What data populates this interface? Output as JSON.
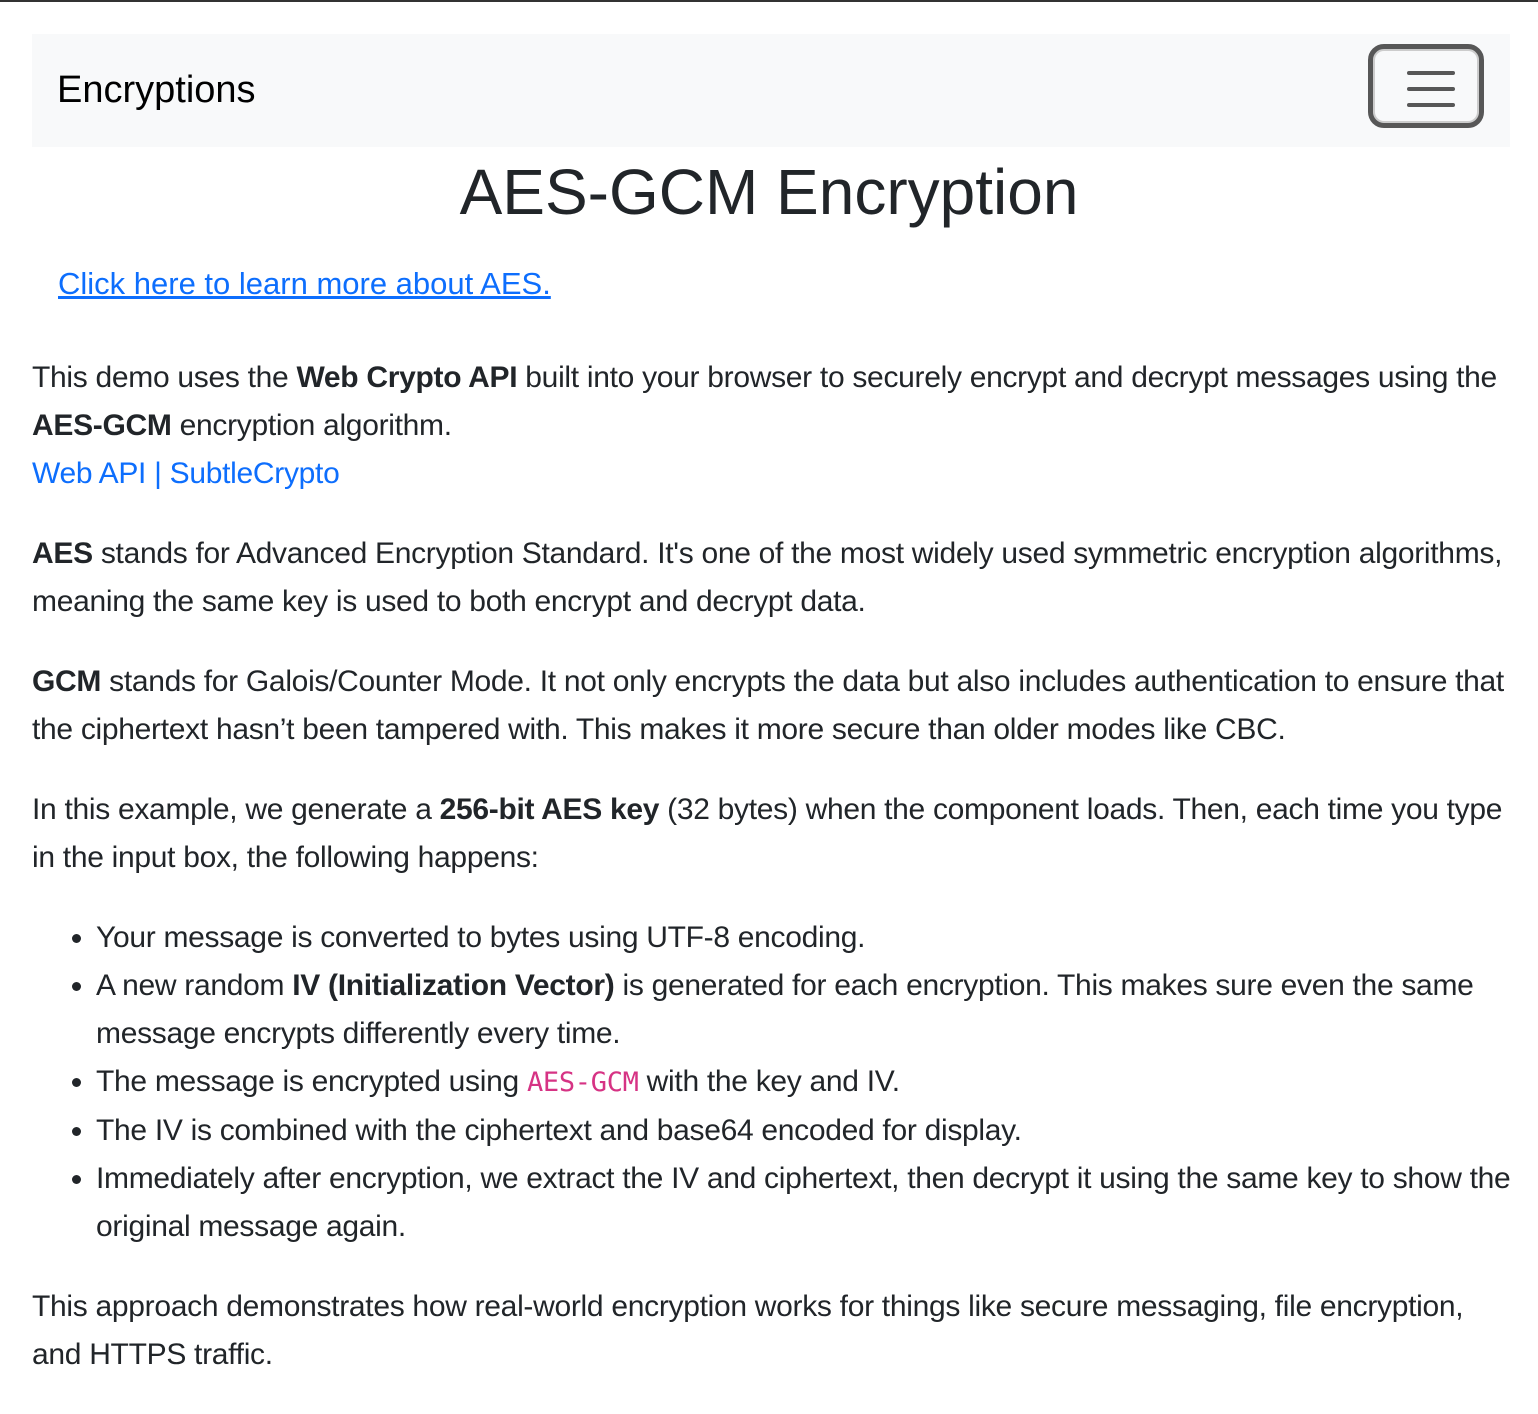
{
  "navbar": {
    "brand": "Encryptions",
    "toggler_icon": "hamburger-menu-icon"
  },
  "title": "AES-GCM Encryption",
  "learn_link": "Click here to learn more about AES.",
  "p1": {
    "a": "This demo uses the ",
    "b": "Web Crypto API",
    "c": " built into your browser to securely encrypt and decrypt messages using the ",
    "d": "AES-GCM",
    "e": " encryption algorithm.",
    "link": "Web API | SubtleCrypto"
  },
  "p2": {
    "b": "AES",
    "t": " stands for Advanced Encryption Standard. It's one of the most widely used symmetric encryption algorithms, meaning the same key is used to both encrypt and decrypt data."
  },
  "p3": {
    "b": "GCM",
    "t": " stands for Galois/Counter Mode. It not only encrypts the data but also includes authentication to ensure that the ciphertext hasn’t been tampered with. This makes it more secure than older modes like CBC."
  },
  "p4": {
    "a": "In this example, we generate a ",
    "b": "256-bit AES key",
    "c": " (32 bytes) when the component loads. Then, each time you type in the input box, the following happens:"
  },
  "list": {
    "i0": "Your message is converted to bytes using UTF-8 encoding.",
    "i1a": "A new random ",
    "i1b": "IV (Initialization Vector)",
    "i1c": " is generated for each encryption. This makes sure even the same message encrypts differently every time.",
    "i2a": "The message is encrypted using ",
    "i2code": "AES-GCM",
    "i2c": " with the key and IV.",
    "i3": "The IV is combined with the ciphertext and base64 encoded for display.",
    "i4": "Immediately after encryption, we extract the IV and ciphertext, then decrypt it using the same key to show the original message again."
  },
  "p5": "This approach demonstrates how real-world encryption works for things like secure messaging, file encryption, and HTTPS traffic."
}
